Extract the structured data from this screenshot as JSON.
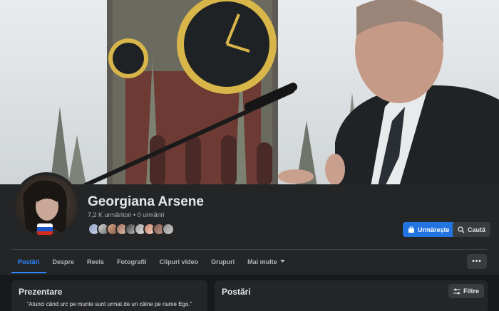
{
  "profile": {
    "name": "Georgiana Arsene",
    "stats": "7,2 K urmăritori • 0 urmăriri"
  },
  "actions": {
    "follow_label": "Urmărește",
    "search_label": "Caută"
  },
  "tabs": [
    {
      "label": "Postări",
      "active": true
    },
    {
      "label": "Despre"
    },
    {
      "label": "Reels"
    },
    {
      "label": "Fotografii"
    },
    {
      "label": "Clipuri video"
    },
    {
      "label": "Grupuri"
    },
    {
      "label": "Mai multe"
    }
  ],
  "more_options": "•••",
  "intro": {
    "title": "Prezentare",
    "quote": "\"Atunci când urc pe munte sunt urmat de un câine pe nume Ego.\""
  },
  "posts": {
    "title": "Postări",
    "filter_label": "Filtre"
  },
  "colors": {
    "accent": "#2d88ff",
    "follow_button": "#2374e1",
    "background": "#18191a",
    "panel": "#242526"
  },
  "icons": {
    "follow": "messenger-follow-icon",
    "search": "search-icon",
    "filter": "sliders-icon",
    "dropdown": "caret-down-icon",
    "avatar_badge": "russian-flag-icon"
  }
}
